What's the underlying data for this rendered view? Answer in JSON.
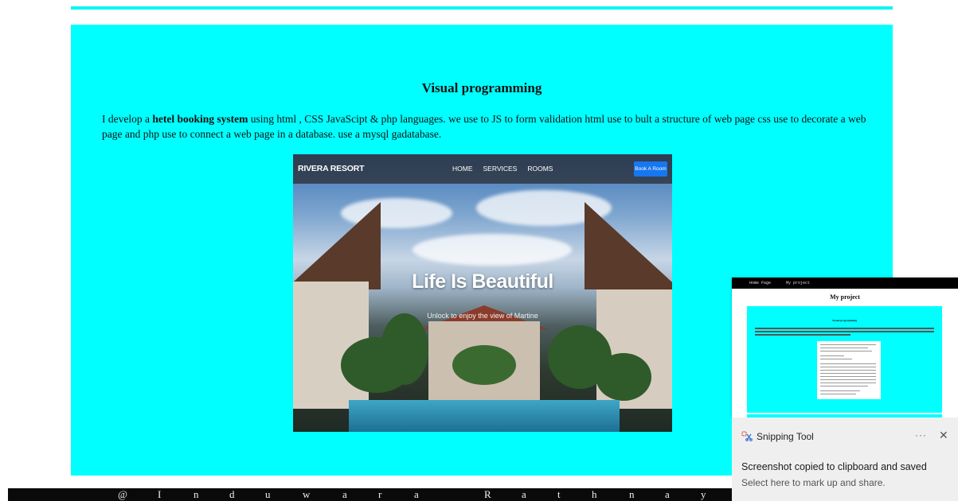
{
  "section": {
    "title": "Visual programming",
    "description": {
      "before": "I develop a ",
      "bold": "hetel booking system",
      "after": " using html , CSS JavaScipt & php languages. we use to JS to form validation html use to bult a structure of web page css use to decorate a web page and php use to connect a web page in a database. use a mysql gadatabase."
    }
  },
  "project_image": {
    "brand": "RIVERA RESORT",
    "nav_links": [
      "HOME",
      "SERVICES",
      "ROOMS"
    ],
    "book_button": "Book A Room",
    "hero_title": "Life Is Beautiful",
    "hero_subtitle": "Unlock to enjoy the view of Martine"
  },
  "footer": {
    "letters": [
      "@",
      "I",
      "n",
      "d",
      "u",
      "w",
      "a",
      "r",
      "a",
      "R",
      "a",
      "t",
      "h",
      "n",
      "a",
      "y"
    ]
  },
  "thumbnail": {
    "nav": [
      "Home Page",
      "My project"
    ],
    "title": "My project",
    "card_heading": "Visual programming"
  },
  "snipping_tool": {
    "app_name": "Snipping Tool",
    "more": "···",
    "close": "✕",
    "message": "Screenshot copied to clipboard and saved",
    "sub": "Select here to mark up and share."
  },
  "colors": {
    "accent_cyan": "#00ffff",
    "footer_bg": "#0a0a0a",
    "book_button": "#1677f0"
  }
}
